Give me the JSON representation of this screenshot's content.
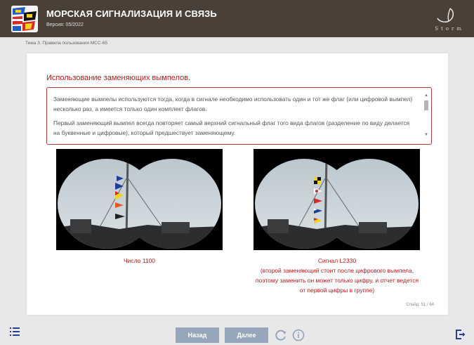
{
  "header": {
    "title": "МОРСКАЯ СИГНАЛИЗАЦИЯ И СВЯЗЬ",
    "version": "Версия: 05/2022",
    "brand": "Storm"
  },
  "breadcrumb": "Тема 3. Правила пользования МСС-65",
  "content": {
    "section_title": "Использование заменяющих вымпелов.",
    "paragraphs": [
      "Заменяющие вымпелы используются тогда, когда в сигнале необходимо использовать один и тот же флаг (или цифровой вымпел) несколько раз, а имеется только один комплект флагов.",
      "Первый заменяющий вымпел всегда повторяет самый верхний сигнальный флаг того вида флагов (разделение по виду делается на буквенные и цифровые), который предшествует заменяющему."
    ],
    "caption_left": "Число 1100",
    "caption_right_title": "Сигнал L2330",
    "caption_right_lines": [
      "(второй заменяющий стоит после цифрового вымпела,",
      "поэтому заменить он может только цифру, и отчет ведется",
      "от первой цифры в группе)"
    ],
    "slide_counter": "Слайд: 51 / 64"
  },
  "footer": {
    "back_label": "Назад",
    "next_label": "Далее"
  },
  "icons": {
    "menu": "list-menu-icon",
    "reload": "reload-icon",
    "info": "info-icon",
    "exit": "exit-icon"
  },
  "colors": {
    "header_bg": "#4a4038",
    "accent_red": "#b11c1c",
    "button_bg": "#97a7bb",
    "page_bg": "#e9e8e8"
  }
}
